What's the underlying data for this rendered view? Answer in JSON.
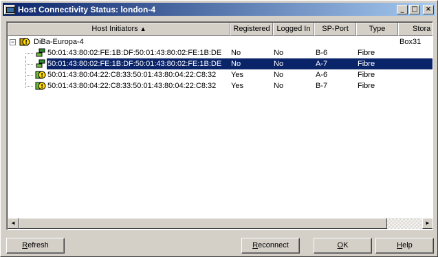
{
  "window": {
    "title": "Host Connectivity Status: london-4",
    "minimize": "_",
    "maximize": "□",
    "close": "×"
  },
  "columns": [
    {
      "label": "Host Initiators",
      "sort": "▲"
    },
    {
      "label": "Registered"
    },
    {
      "label": "Logged In"
    },
    {
      "label": "SP-Port"
    },
    {
      "label": "Type"
    },
    {
      "label": "Stora"
    }
  ],
  "host": {
    "name": "DiBa-Europa-4",
    "storage": "Box31",
    "expander": "−"
  },
  "initiators": [
    {
      "wwn": "50:01:43:80:02:FE:1B:DF:50:01:43:80:02:FE:1B:DE",
      "registered": "No",
      "logged_in": "No",
      "sp_port": "B-6",
      "type": "Fibre",
      "selected": false
    },
    {
      "wwn": "50:01:43:80:02:FE:1B:DF:50:01:43:80:02:FE:1B:DE",
      "registered": "No",
      "logged_in": "No",
      "sp_port": "A-7",
      "type": "Fibre",
      "selected": true
    },
    {
      "wwn": "50:01:43:80:04:22:C8:33:50:01:43:80:04:22:C8:32",
      "registered": "Yes",
      "logged_in": "No",
      "sp_port": "A-6",
      "type": "Fibre",
      "selected": false
    },
    {
      "wwn": "50:01:43:80:04:22:C8:33:50:01:43:80:04:22:C8:32",
      "registered": "Yes",
      "logged_in": "No",
      "sp_port": "B-7",
      "type": "Fibre",
      "selected": false
    }
  ],
  "scrollbar": {
    "left_arrow": "◄",
    "right_arrow": "►"
  },
  "buttons": {
    "refresh": {
      "first": "R",
      "rest": "efresh"
    },
    "reconnect": {
      "first": "R",
      "rest": "econnect"
    },
    "ok": {
      "first": "O",
      "rest": "K"
    },
    "help": {
      "first": "H",
      "rest": "elp"
    }
  },
  "colors": {
    "selection": "#0a246a",
    "title_bar_start": "#0a246a",
    "title_bar_end": "#a6caf0",
    "face": "#d4d0c8"
  }
}
